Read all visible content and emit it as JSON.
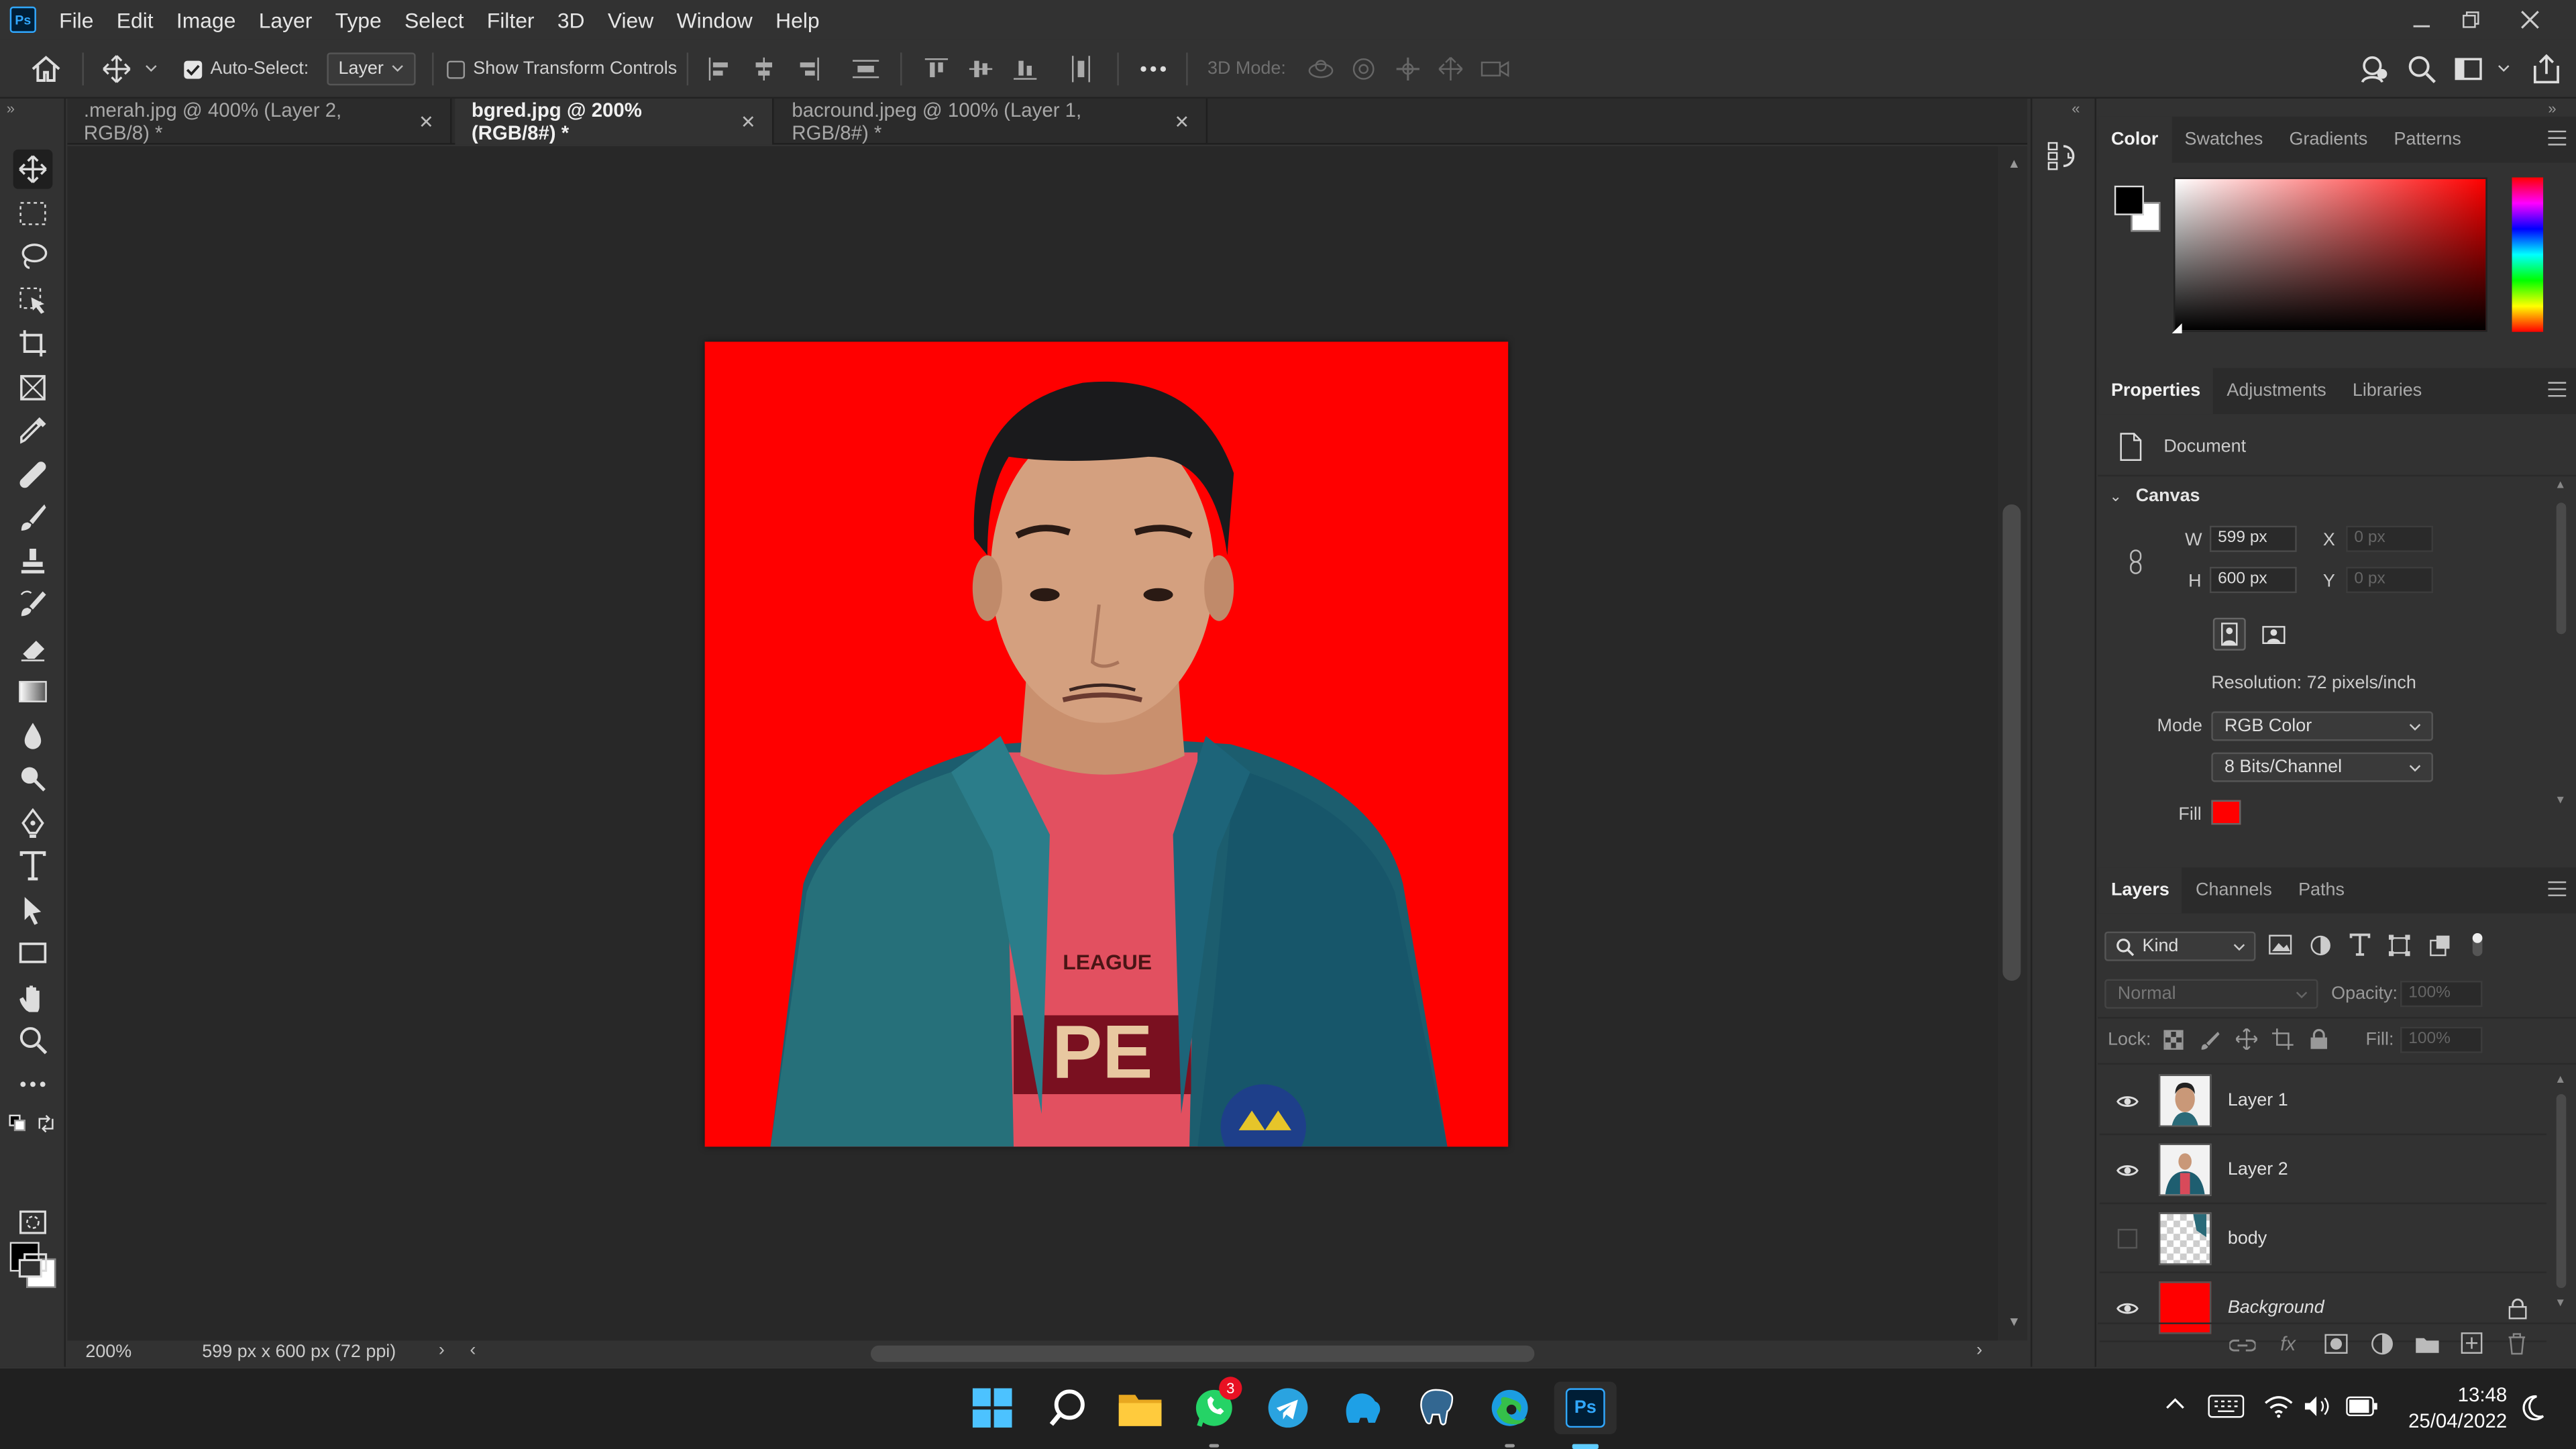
{
  "app": {
    "logo": "Ps",
    "accent": "#31a8ff"
  },
  "menu": [
    "File",
    "Edit",
    "Image",
    "Layer",
    "Type",
    "Select",
    "Filter",
    "3D",
    "View",
    "Window",
    "Help"
  ],
  "options": {
    "auto_select_label": "Auto-Select:",
    "auto_select_checked": true,
    "auto_select_value": "Layer",
    "show_transform_label": "Show Transform Controls",
    "show_transform_checked": false,
    "three_d_mode_label": "3D Mode:"
  },
  "tabs": [
    {
      "label": ".merah.jpg @ 400% (Layer 2, RGB/8) *",
      "active": false
    },
    {
      "label": "bgred.jpg @ 200% (RGB/8#) *",
      "active": true
    },
    {
      "label": "bacround.jpeg @ 100% (Layer 1, RGB/8#) *",
      "active": false
    }
  ],
  "document": {
    "background_color": "#ff0000",
    "shirt_text": "LEAGUE",
    "shirt_big_text": "PE"
  },
  "status": {
    "zoom": "200%",
    "info": "599 px x 600 px (72 ppi)"
  },
  "color_panel": {
    "tabs": [
      "Color",
      "Swatches",
      "Gradients",
      "Patterns"
    ],
    "foreground": "#000000",
    "background": "#ffffff",
    "hue": "#ff0000"
  },
  "properties_panel": {
    "tabs": [
      "Properties",
      "Adjustments",
      "Libraries"
    ],
    "doc_label": "Document",
    "section": "Canvas",
    "w_label": "W",
    "w_value": "599 px",
    "h_label": "H",
    "h_value": "600 px",
    "x_label": "X",
    "x_value": "0 px",
    "y_label": "Y",
    "y_value": "0 px",
    "resolution": "Resolution: 72 pixels/inch",
    "mode_label": "Mode",
    "mode_value": "RGB Color",
    "depth_value": "8 Bits/Channel",
    "fill_label": "Fill",
    "fill_color": "#ff0000"
  },
  "layers_panel": {
    "tabs": [
      "Layers",
      "Channels",
      "Paths"
    ],
    "filter_kind": "Kind",
    "blend_mode": "Normal",
    "opacity_label": "Opacity:",
    "opacity_value": "100%",
    "lock_label": "Lock:",
    "fill_label": "Fill:",
    "fill_value": "100%",
    "layers": [
      {
        "name": "Layer 1",
        "visible": true,
        "thumb": "face"
      },
      {
        "name": "Layer 2",
        "visible": true,
        "thumb": "body"
      },
      {
        "name": "body",
        "visible": false,
        "thumb": "transparent"
      },
      {
        "name": "Background",
        "visible": true,
        "thumb": "red",
        "locked": true
      }
    ]
  },
  "taskbar": {
    "whatsapp_badge": "3",
    "time": "13:48",
    "date": "25/04/2022"
  }
}
